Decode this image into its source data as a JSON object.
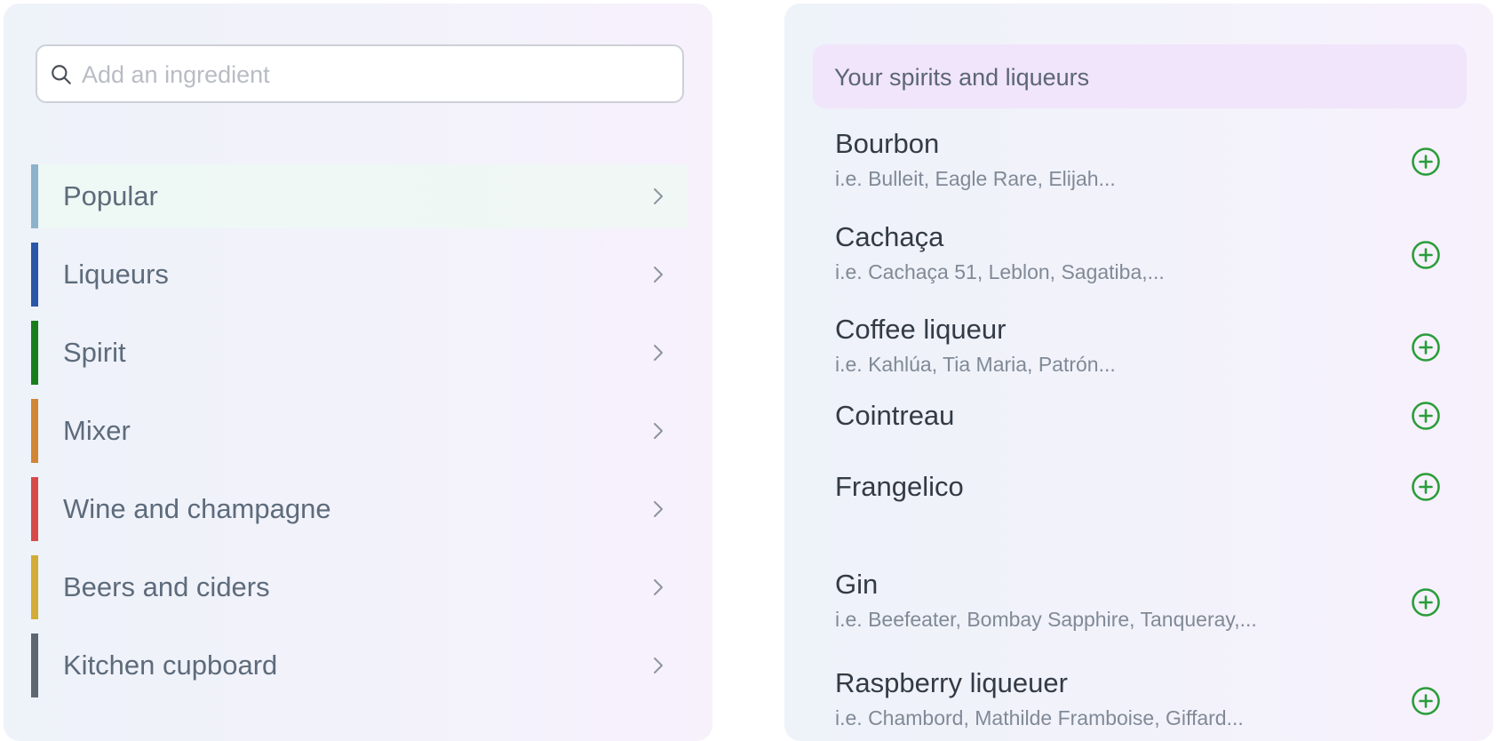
{
  "search": {
    "placeholder": "Add an ingredient",
    "icon": "search-icon"
  },
  "categories": [
    {
      "label": "Popular",
      "color": "#8db3cb",
      "active": true
    },
    {
      "label": "Liqueurs",
      "color": "#2a57a8",
      "active": false
    },
    {
      "label": "Spirit",
      "color": "#1a7d1c",
      "active": false
    },
    {
      "label": "Mixer",
      "color": "#d18636",
      "active": false
    },
    {
      "label": "Wine and champagne",
      "color": "#d64a4a",
      "active": false
    },
    {
      "label": "Beers and ciders",
      "color": "#d3ac37",
      "active": false
    },
    {
      "label": "Kitchen cupboard",
      "color": "#5e6672",
      "active": false
    }
  ],
  "panel": {
    "title": "Your spirits and liqueurs",
    "items": [
      {
        "name": "Bourbon",
        "examples": "i.e. Bulleit, Eagle Rare, Elijah..."
      },
      {
        "name": "Cachaça",
        "examples": "i.e. Cachaça 51, Leblon, Sagatiba,..."
      },
      {
        "name": "Coffee liqueur",
        "examples": "i.e. Kahlúa, Tia Maria, Patrón..."
      },
      {
        "name": "Cointreau",
        "examples": ""
      },
      {
        "name": "Frangelico",
        "examples": ""
      },
      {
        "name": "Gin",
        "examples": "i.e. Beefeater, Bombay Sapphire, Tanqueray,..."
      },
      {
        "name": "Raspberry liqueuer",
        "examples": "i.e. Chambord, Mathilde Framboise, Giffard..."
      }
    ]
  },
  "colors": {
    "add_icon": "#2a9d3a",
    "header_bg": "#f1e5fb"
  }
}
